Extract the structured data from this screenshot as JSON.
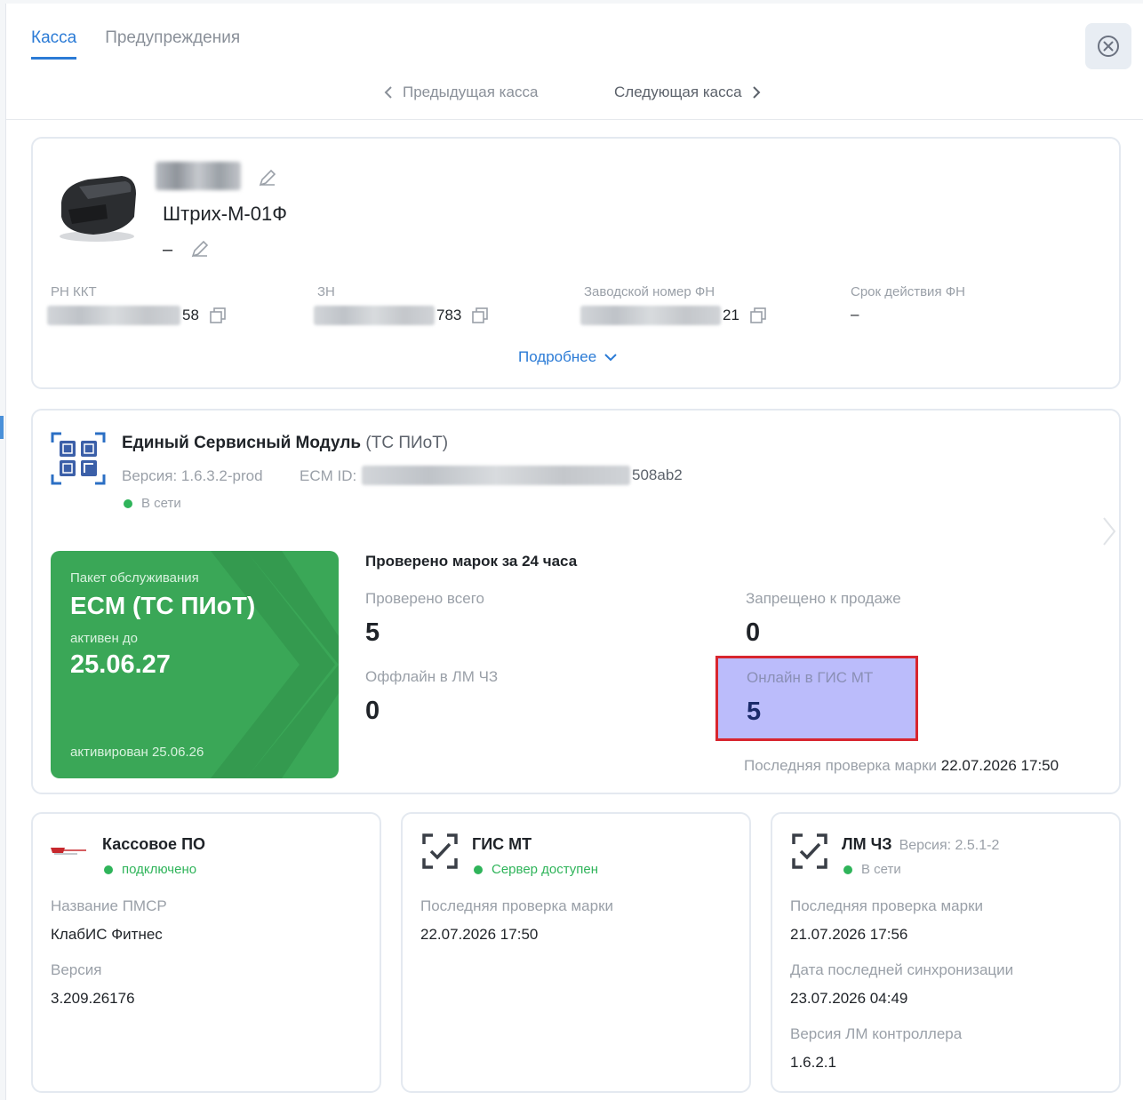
{
  "tabs": [
    {
      "label": "Касса",
      "active": true
    },
    {
      "label": "Предупреждения",
      "active": false
    }
  ],
  "nav": {
    "prev_label": "Предыдущая касса",
    "next_label": "Следующая касса"
  },
  "kkt": {
    "model": "Штрих-М-01Ф",
    "secondary_name": "–",
    "fields": [
      {
        "label": "РН ККТ",
        "visible_suffix": "58"
      },
      {
        "label": "ЗН",
        "visible_suffix": "783"
      },
      {
        "label": "Заводской номер ФН",
        "visible_suffix": "21"
      },
      {
        "label": "Срок действия ФН",
        "value": "–"
      }
    ],
    "more_label": "Подробнее"
  },
  "ecm": {
    "title": "Единый Сервисный Модуль",
    "title_suffix": "(ТС ПИоТ)",
    "version": "Версия: 1.6.3.2-prod",
    "id_label": "ECM ID:",
    "id_suffix": "508ab2",
    "status": "В сети",
    "package": {
      "label": "Пакет обслуживания",
      "name": "ECM (ТС ПИоТ)",
      "active_label": "активен до",
      "active_until": "25.06.27",
      "activated": "активирован 25.06.26"
    },
    "checks": {
      "title": "Проверено марок за 24 часа",
      "total_label": "Проверено всего",
      "total_value": "5",
      "forbidden_label": "Запрещено к продаже",
      "forbidden_value": "0",
      "offline_label": "Оффлайн в ЛМ ЧЗ",
      "offline_value": "0",
      "online_label": "Онлайн в ГИС МТ",
      "online_value": "5",
      "last_check_label": "Последняя проверка марки",
      "last_check_value": "22.07.2026 17:50"
    }
  },
  "pos": {
    "title": "Кассовое ПО",
    "status": "подключено",
    "name_label": "Название ПМСР",
    "name_value": "КлабИС Фитнес",
    "version_label": "Версия",
    "version_value": "3.209.26176"
  },
  "gis": {
    "title": "ГИС МТ",
    "status": "Сервер доступен",
    "last_check_label": "Последняя проверка марки",
    "last_check_value": "22.07.2026 17:50"
  },
  "lm": {
    "title": "ЛМ ЧЗ",
    "version": "Версия: 2.5.1-2",
    "status": "В сети",
    "last_check_label": "Последняя проверка марки",
    "last_check_value": "21.07.2026 17:56",
    "sync_label": "Дата последней синхронизации",
    "sync_value": "23.07.2026 04:49",
    "controller_label": "Версия ЛМ контроллера",
    "controller_value": "1.6.2.1"
  },
  "colors": {
    "accent": "#2b7bd6",
    "package_green": "#3aa757",
    "status_green": "#2fb45a",
    "highlight_fill": "#bbbcfb",
    "highlight_border": "#d8262f"
  },
  "icons": [
    "close-icon",
    "chevron-left-icon",
    "chevron-right-icon",
    "edit-icon",
    "copy-icon",
    "chevron-down-icon",
    "ecm-module-icon",
    "scan-check-icon",
    "pos-logo-icon"
  ]
}
